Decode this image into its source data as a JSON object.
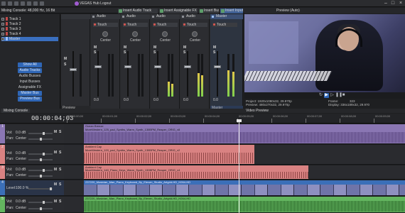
{
  "app": {
    "title": "VEGAS Hub Logout"
  },
  "mixing_console": {
    "header": "Mixing Console: 48,000 Hz, 16 Bit",
    "tracks": [
      {
        "label": "Track 1",
        "color": "#c24a4a"
      },
      {
        "label": "Track 2",
        "color": "#c24a4a"
      },
      {
        "label": "Track 3",
        "color": "#c24a4a"
      },
      {
        "label": "Track 4",
        "color": "#c24a4a"
      },
      {
        "label": "Master",
        "color": "#3a6fbf"
      }
    ],
    "buttons": [
      "Show All",
      "Audio Tracks",
      "Audio Busses",
      "Input Busses",
      "Assignable FX",
      "Master Bus",
      "Preview Bus"
    ],
    "toolbar": [
      "Insert Audio Track",
      "Insert Assignable FX",
      "Insert Bus",
      "Insert Input Bus"
    ],
    "strips": [
      {
        "name": "Preview",
        "header": "",
        "pan": "",
        "value": "",
        "footer": "Preview",
        "meter": 0
      },
      {
        "name": "Audio",
        "header": "Audio",
        "pan": "Center",
        "value": "0.0",
        "footer": "",
        "meter": 0
      },
      {
        "name": "Audio",
        "header": "Audio",
        "pan": "Center",
        "value": "0.0",
        "footer": "",
        "meter": 0
      },
      {
        "name": "Audio",
        "header": "Audio",
        "pan": "Center",
        "value": "0.0",
        "footer": "",
        "meter": 0.35
      },
      {
        "name": "Audio",
        "header": "Audio",
        "pan": "Center",
        "value": "0.0",
        "footer": "",
        "meter": 0.55
      },
      {
        "name": "Master",
        "header": "Master",
        "pan": "",
        "value": "0.0",
        "footer": "Master",
        "meter": 0.62
      }
    ],
    "touch_label": "Touch",
    "tab": "Mixing Console"
  },
  "preview": {
    "header": "Preview (Auto)",
    "project": "Project: 1920x1080x32, 29.970p",
    "preview_res": "Preview: 480x270x32, 29.970p",
    "display": "Display: 336x189x32, 29.970",
    "frame": "Frame:",
    "frame_value": "323",
    "tab": "Video Preview"
  },
  "timeline": {
    "timecode": "00:00:04;03",
    "ruler": [
      "00:00:00;00",
      "00:00:01;00",
      "00:00:02;00",
      "00:00:03;00",
      "00:00:04;00",
      "00:00:05;00",
      "00:00:06;00",
      "00:00:07;00",
      "00:00:08;00",
      "00:00:09;00"
    ],
    "tracks": [
      {
        "num": "1",
        "vol": "Vol:",
        "vol_val": "0.0 dB",
        "pan": "Pan:",
        "pan_val": "Center",
        "clip_title": "Ocean Breeze",
        "clip_sub": "MoreWestern_125_pad_Synths_Warm_Synth_130BPM_Reaper_ORIG_v8"
      },
      {
        "num": "2",
        "vol": "Vol:",
        "vol_val": "0.0 dB",
        "pan": "Pan:",
        "pan_val": "Center",
        "clip_title": "Ambient Cap",
        "clip_sub": "MoreWestern_120_pad_Synths_Warm_Synth_130BPM_Reaper_ORIG_v2"
      },
      {
        "num": "3",
        "vol": "Vol:",
        "vol_val": "0.0 dB",
        "pan": "Pan:",
        "pan_val": "Center",
        "clip_title": "Ambient Cap",
        "clip_sub": "MoreWestern_140_Piano_Keys_Warm_Synth_130BPM_Reaper_ORIG_v4"
      },
      {
        "num": "4",
        "vol": "Level:",
        "vol_val": "100.0 %",
        "pan": "",
        "pan_val": "",
        "clip_title": "237220_Musician_Man_Piano_Keyboard_By_Eleven_Studio_Artgrid-HD_H264-HD",
        "clip_sub": ""
      },
      {
        "num": "5",
        "vol": "Vol:",
        "vol_val": "0.0 dB",
        "pan": "Pan:",
        "pan_val": "Center",
        "clip_title": "237220_Musician_Man_Piano_Keyboard_By_Eleven_Studio_Artgrid-HD_H264-HD",
        "clip_sub": ""
      }
    ]
  }
}
